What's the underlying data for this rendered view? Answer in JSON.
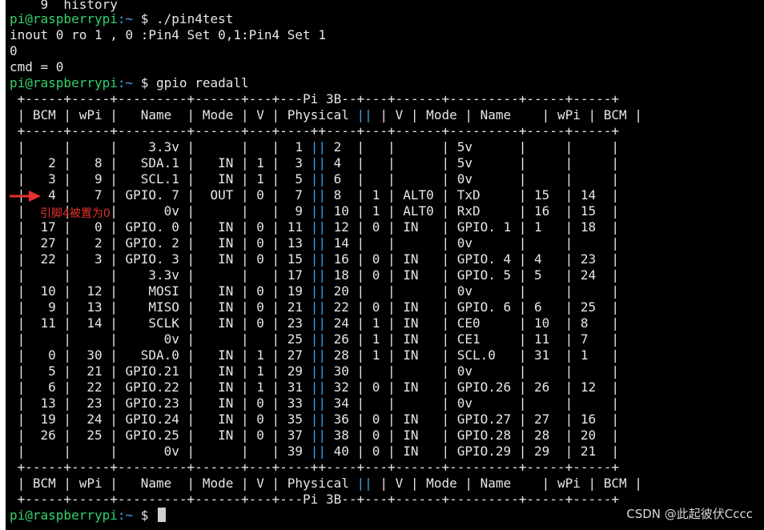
{
  "terminal": {
    "history_line": "    9  history",
    "prompt_user": "pi@raspberrypi",
    "prompt_path": ":~ ",
    "prompt_sym": "$ ",
    "cmd1": "./pin4test",
    "out1": "inout 0 ro 1 , 0 :Pin4 Set 0,1:Pin4 Set 1",
    "out2": "0",
    "out3": "cmd = 0",
    "cmd2": "gpio readall"
  },
  "table": {
    "border_top": " +-----+-----+---------+------+---+---Pi 3B--+---+------+---------+-----+-----+",
    "border_mid": " +-----+-----+---------+------+---+----++----+---+------+---------+-----+-----+",
    "border_bottom": " +-----+-----+---------+------+---+---Pi 3B--+---+------+---------+-----+-----+",
    "header_left": " | BCM | wPi |   Name  | Mode | V | Physical ",
    "header_right": " | V | Mode | Name    | wPi | BCM |",
    "rows": [
      {
        "l": " |     |     |    3.3v |      |   |  1 ",
        "r": " 2  |   |      | 5v      |     |     |"
      },
      {
        "l": " |   2 |   8 |   SDA.1 |   IN | 1 |  3 ",
        "r": " 4  |   |      | 5v      |     |     |"
      },
      {
        "l": " |   3 |   9 |   SCL.1 |   IN | 1 |  5 ",
        "r": " 6  |   |      | 0v      |     |     |"
      },
      {
        "l": " |   4 |   7 | GPIO. 7 |  OUT | 0 |  7 ",
        "r": " 8  | 1 | ALT0 | TxD     | 15  | 14  |"
      },
      {
        "l": " |     |     |      0v |      |   |  9 ",
        "r": " 10 | 1 | ALT0 | RxD     | 16  | 15  |"
      },
      {
        "l": " |  17 |   0 | GPIO. 0 |   IN | 0 | 11 ",
        "r": " 12 | 0 | IN   | GPIO. 1 | 1   | 18  |"
      },
      {
        "l": " |  27 |   2 | GPIO. 2 |   IN | 0 | 13 ",
        "r": " 14 |   |      | 0v      |     |     |"
      },
      {
        "l": " |  22 |   3 | GPIO. 3 |   IN | 0 | 15 ",
        "r": " 16 | 0 | IN   | GPIO. 4 | 4   | 23  |"
      },
      {
        "l": " |     |     |    3.3v |      |   | 17 ",
        "r": " 18 | 0 | IN   | GPIO. 5 | 5   | 24  |"
      },
      {
        "l": " |  10 |  12 |    MOSI |   IN | 0 | 19 ",
        "r": " 20 |   |      | 0v      |     |     |"
      },
      {
        "l": " |   9 |  13 |    MISO |   IN | 0 | 21 ",
        "r": " 22 | 0 | IN   | GPIO. 6 | 6   | 25  |"
      },
      {
        "l": " |  11 |  14 |    SCLK |   IN | 0 | 23 ",
        "r": " 24 | 1 | IN   | CE0     | 10  | 8   |"
      },
      {
        "l": " |     |     |      0v |      |   | 25 ",
        "r": " 26 | 1 | IN   | CE1     | 11  | 7   |"
      },
      {
        "l": " |   0 |  30 |   SDA.0 |   IN | 1 | 27 ",
        "r": " 28 | 1 | IN   | SCL.0   | 31  | 1   |"
      },
      {
        "l": " |   5 |  21 | GPIO.21 |   IN | 1 | 29 ",
        "r": " 30 |   |      | 0v      |     |     |"
      },
      {
        "l": " |   6 |  22 | GPIO.22 |   IN | 1 | 31 ",
        "r": " 32 | 0 | IN   | GPIO.26 | 26  | 12  |"
      },
      {
        "l": " |  13 |  23 | GPIO.23 |   IN | 0 | 33 ",
        "r": " 34 |   |      | 0v      |     |     |"
      },
      {
        "l": " |  19 |  24 | GPIO.24 |   IN | 0 | 35 ",
        "r": " 36 | 0 | IN   | GPIO.27 | 27  | 16  |"
      },
      {
        "l": " |  26 |  25 | GPIO.25 |   IN | 0 | 37 ",
        "r": " 38 | 0 | IN   | GPIO.28 | 28  | 20  |"
      },
      {
        "l": " |     |     |      0v |      |   | 39 ",
        "r": " 40 | 0 | IN   | GPIO.29 | 29  | 21  |"
      }
    ]
  },
  "annotation": {
    "note": "引脚4被置为0",
    "arrow_color": "#e5322d"
  },
  "watermark": "CSDN @此起彼伏Cccc",
  "colors": {
    "background": "#000000",
    "prompt_user": "#33d26b",
    "prompt_path": "#4aa3ff",
    "separator": "#3aa0e6",
    "annotation": "#e5322d"
  }
}
